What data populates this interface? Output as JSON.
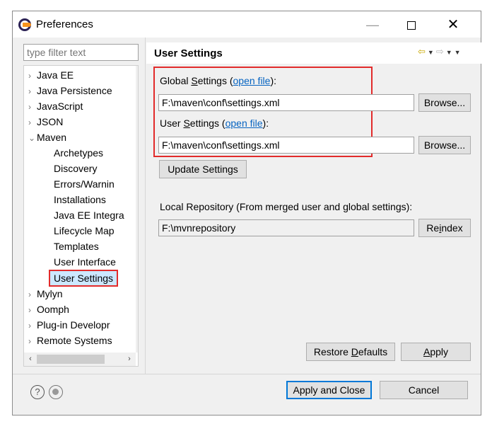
{
  "window": {
    "title": "Preferences"
  },
  "filter": {
    "placeholder": "type filter text"
  },
  "tree": {
    "items": [
      {
        "label": "Java EE",
        "arrow": "›"
      },
      {
        "label": "Java Persistence",
        "arrow": "›"
      },
      {
        "label": "JavaScript",
        "arrow": "›"
      },
      {
        "label": "JSON",
        "arrow": "›"
      },
      {
        "label": "Maven",
        "arrow": "⌄"
      },
      {
        "label": "Archetypes"
      },
      {
        "label": "Discovery"
      },
      {
        "label": "Errors/Warnin"
      },
      {
        "label": "Installations"
      },
      {
        "label": "Java EE Integra"
      },
      {
        "label": "Lifecycle Map"
      },
      {
        "label": "Templates"
      },
      {
        "label": "User Interface"
      },
      {
        "label": "User Settings"
      },
      {
        "label": "Mylyn",
        "arrow": "›"
      },
      {
        "label": "Oomph",
        "arrow": "›"
      },
      {
        "label": "Plug-in Developr",
        "arrow": "›"
      },
      {
        "label": "Remote Systems",
        "arrow": "›"
      }
    ]
  },
  "page": {
    "title": "User Settings",
    "global_label_pre": "Global ",
    "global_label_u": "S",
    "global_label_mid": "ettings (",
    "global_link": "open file",
    "global_label_post": "):",
    "global_value": "F:\\maven\\conf\\settings.xml",
    "user_label_pre": "User ",
    "user_label_u": "S",
    "user_label_mid": "ettings (",
    "user_link": "open file",
    "user_label_post": "):",
    "user_value": "F:\\maven\\conf\\settings.xml",
    "browse": "Browse...",
    "update_settings": "Update Settings",
    "local_repo_label": "Local Repository (From merged user and global settings):",
    "local_repo_value": "F:\\mvnrepository",
    "reindex_pre": "Re",
    "reindex_u": "i",
    "reindex_post": "ndex"
  },
  "buttons": {
    "restore_pre": "Restore ",
    "restore_u": "D",
    "restore_post": "efaults",
    "apply_u": "A",
    "apply_post": "pply",
    "apply_close": "Apply and Close",
    "cancel": "Cancel"
  },
  "icons": {
    "help": "?",
    "minimize": "—",
    "close": "✕"
  },
  "colors": {
    "highlight": "#e22b2b",
    "link": "#0563c1",
    "selection": "#cce8ff",
    "focus": "#0078d7"
  }
}
